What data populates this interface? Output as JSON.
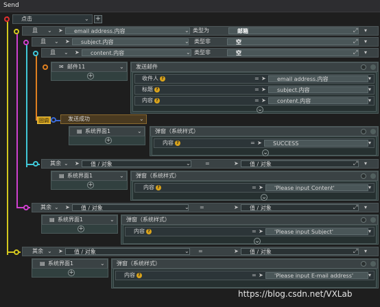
{
  "window": {
    "title": "Send"
  },
  "colors": {
    "red": "#e03030",
    "yellow": "#d4c81e",
    "pink": "#d040d0",
    "cyan": "#40c8d8",
    "orange": "#e08020",
    "blue": "#3a6ad8",
    "green": "#3cb83c"
  },
  "trigger": {
    "label": "点击"
  },
  "cond1": {
    "op": "且",
    "left": "email address.内容",
    "type": "类型为",
    "right": "邮箱"
  },
  "cond2": {
    "op": "且",
    "left": "subject.内容",
    "type": "类型非",
    "right": "空"
  },
  "cond3": {
    "op": "且",
    "left": "content.内容",
    "type": "类型非",
    "right": "空"
  },
  "mail": {
    "node": "邮件11",
    "action": "发送邮件",
    "params": [
      {
        "label": "收件人",
        "value": "email address.内容"
      },
      {
        "label": "标题",
        "value": "subject.内容"
      },
      {
        "label": "内容",
        "value": "content.内容"
      }
    ]
  },
  "callback": {
    "tag": "回调",
    "label": "发送成功"
  },
  "success": {
    "node": "系统界面1",
    "action": "弹窗（系统样式）",
    "param_label": "内容",
    "value": "SUCCESS"
  },
  "else1": {
    "op": "其余",
    "left": "值 / 对象",
    "eq": "=",
    "right": "值 / 对象",
    "node": "系统界面1",
    "action": "弹窗（系统样式）",
    "param_label": "内容",
    "value": "'Please input Content'"
  },
  "else2": {
    "op": "其余",
    "left": "值 / 对象",
    "eq": "=",
    "right": "值 / 对象",
    "node": "系统界面1",
    "action": "弹窗（系统样式）",
    "param_label": "内容",
    "value": "'Please input Subject'"
  },
  "else3": {
    "op": "其余",
    "left": "值 / 对象",
    "eq": "=",
    "right": "值 / 对象",
    "node": "系统界面1",
    "action": "弹窗（系统样式）",
    "param_label": "内容",
    "value": "'Please input E-mail address'"
  },
  "eq_sign": "=",
  "watermark": "https://blog.csdn.net/VXLab"
}
